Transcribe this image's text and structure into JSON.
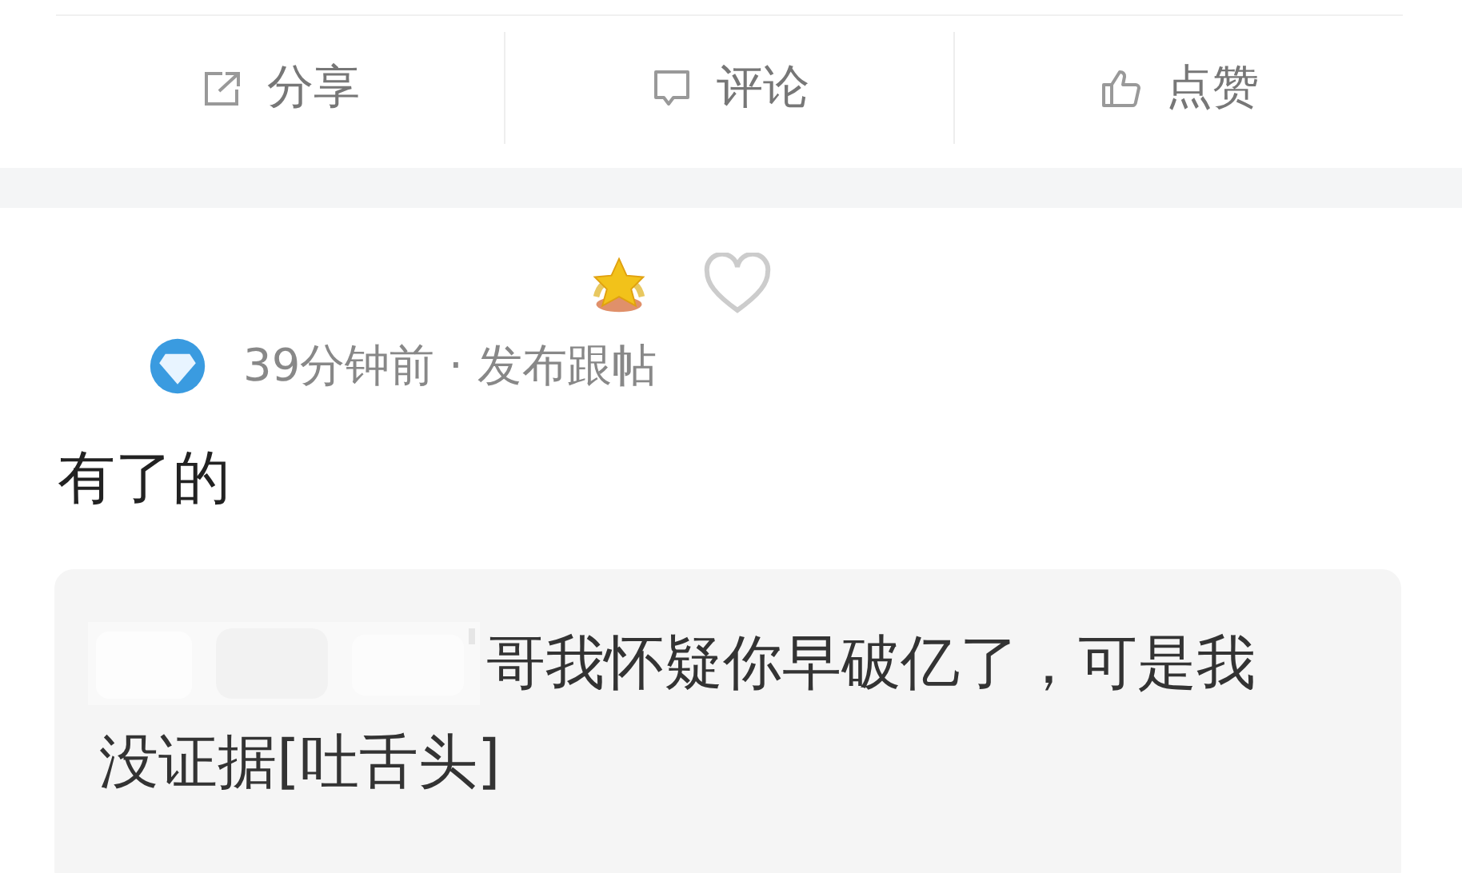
{
  "actions": [
    {
      "kind": "share",
      "label": "分享"
    },
    {
      "kind": "comment",
      "label": "评论"
    },
    {
      "kind": "like",
      "label": "点赞"
    }
  ],
  "post": {
    "liked": false,
    "time": "39分钟前 · 发布跟帖",
    "content": "有了的",
    "quote": {
      "lines": [
        "哥我怀疑你早破亿了，可是我",
        "没证据[吐舌头]"
      ]
    }
  }
}
